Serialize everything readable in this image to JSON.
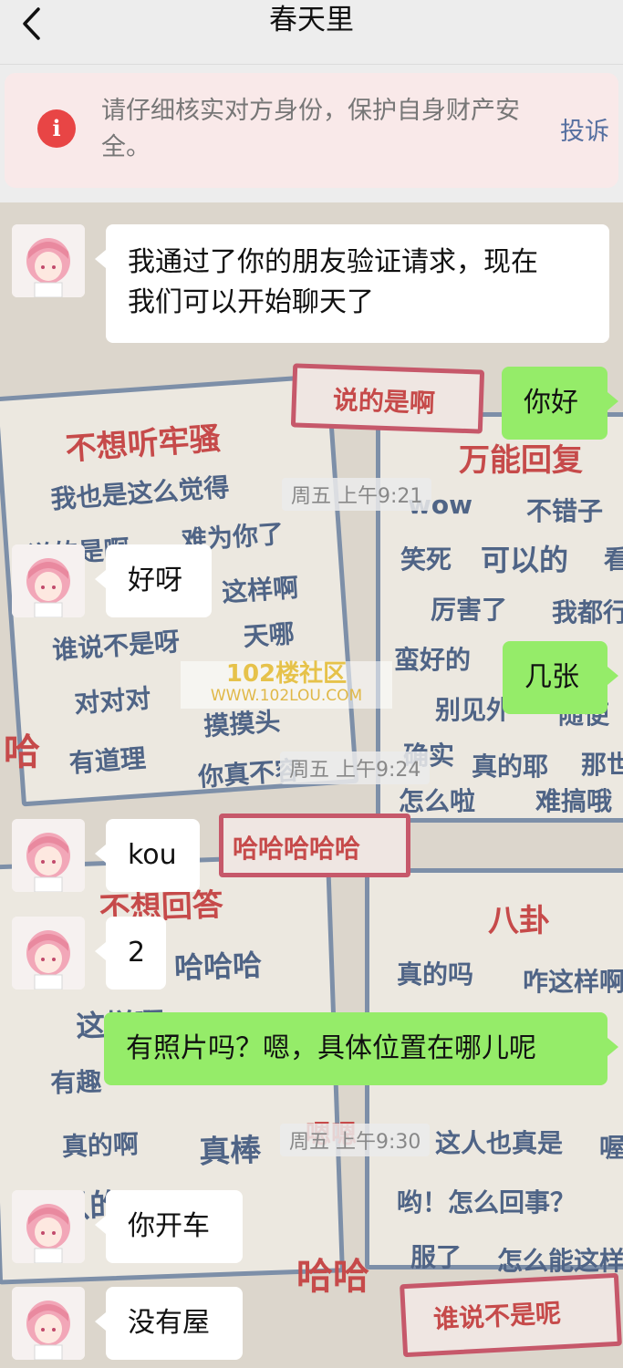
{
  "header": {
    "title": "春天里",
    "back_icon": "chevron-left-icon"
  },
  "warning": {
    "icon": "exclamation-icon",
    "icon_glyph": "i",
    "text": "请仔细核实对方身份，保护自身财产安全。",
    "action": "投诉",
    "accent": "#e84545"
  },
  "background_text": {
    "s1": [
      "不想听牢骚",
      "我也是这么觉得",
      "说的是啊",
      "难为你了",
      "好",
      "这样啊",
      "谁说不是呀",
      "天哪",
      "对对对",
      "摸摸头",
      "有道理",
      "你真不容"
    ],
    "s2": [
      "万能回复",
      "wow",
      "不错子",
      "笑死",
      "可以的",
      "看",
      "厉害了",
      "我都行",
      "蛮好的",
      "别见外",
      "随便",
      "确实",
      "真的耶",
      "那世",
      "怎么啦",
      "难搞哦"
    ],
    "s3": [
      "不想回答",
      "哈哈哈",
      "这样啊",
      "有趣",
      "真的啊",
      "真棒",
      "可以的"
    ],
    "s4": [
      "八卦",
      "真的吗",
      "咋这样啊",
      "这人也真是",
      "喔",
      "哟！怎么回事？",
      "服了",
      "怎么能这样"
    ],
    "misc": [
      "说的是啊",
      "哈哈哈哈哈",
      "嗯嗯",
      "谁说不是呢",
      "哈",
      "哈哈"
    ]
  },
  "watermark": {
    "line1": "102楼社区",
    "line2": "WWW.102LOU.COM"
  },
  "messages": [
    {
      "side": "left",
      "text_lines": [
        "我通过了你的朋友验证请求，现在",
        "我们可以开始聊天了"
      ]
    },
    {
      "side": "right",
      "text": "你好"
    },
    {
      "type": "time",
      "text": "周五 上午9:21"
    },
    {
      "side": "left",
      "text": "好呀"
    },
    {
      "side": "right",
      "text": "几张"
    },
    {
      "type": "time",
      "text": "周五 上午9:24"
    },
    {
      "side": "left",
      "text": "kou"
    },
    {
      "side": "left",
      "text": "2"
    },
    {
      "side": "right",
      "text": "有照片吗？嗯，具体位置在哪儿呢"
    },
    {
      "type": "time",
      "text": "周五 上午9:30"
    },
    {
      "side": "left",
      "text": "你开车"
    },
    {
      "side": "left",
      "text": "没有屋"
    }
  ],
  "colors": {
    "self_bubble": "#95ec69",
    "other_bubble": "#ffffff"
  }
}
